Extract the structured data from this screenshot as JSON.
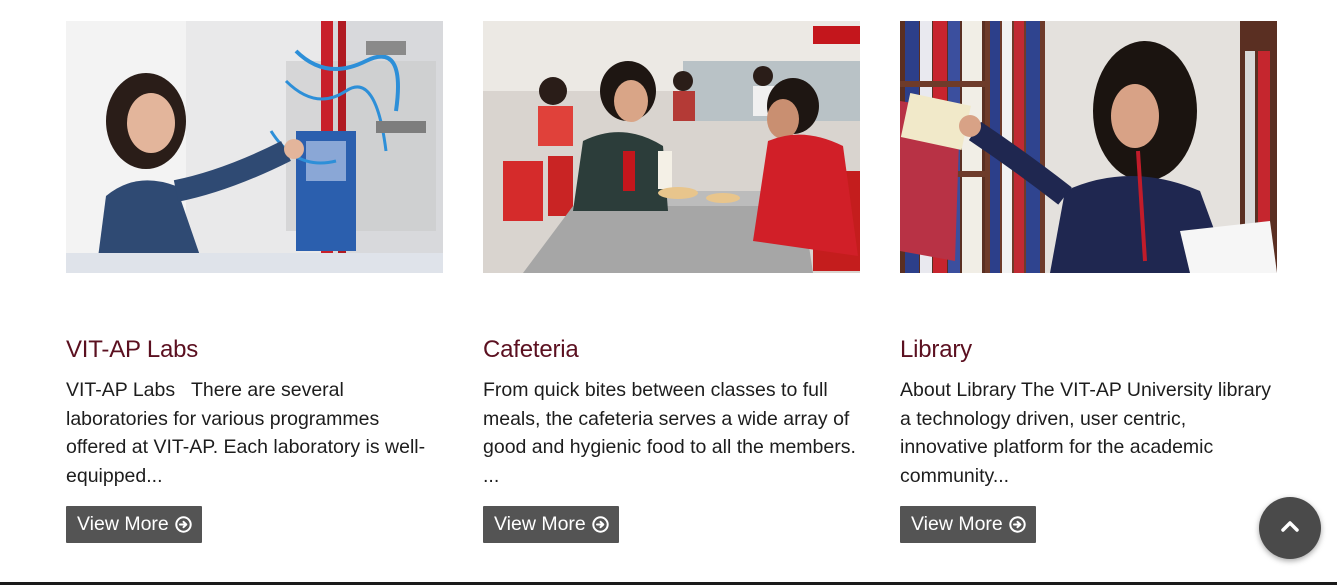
{
  "cards": [
    {
      "title": "VIT-AP Labs",
      "text": "VIT-AP Labs   There are several laboratories for various programmes offered at VIT-AP. Each laboratory is well-equipped...",
      "button_label": "View More",
      "image_alt": "lab-photo"
    },
    {
      "title": "Cafeteria",
      "text": "From quick bites between classes to full meals, the cafeteria serves a wide array of good and hygienic food to all the members. ...",
      "button_label": "View More",
      "image_alt": "cafeteria-photo"
    },
    {
      "title": "Library",
      "text": "About Library The VIT-AP University library a technology driven, user centric, innovative platform for the academic community...",
      "button_label": "View More",
      "image_alt": "library-photo"
    }
  ],
  "icons": {
    "button_icon": "arrow-circle-right-icon",
    "scroll_icon": "chevron-up-icon"
  },
  "colors": {
    "title": "#5b1020",
    "button_bg": "#545454",
    "scroll_bg": "#4a4a4a"
  }
}
